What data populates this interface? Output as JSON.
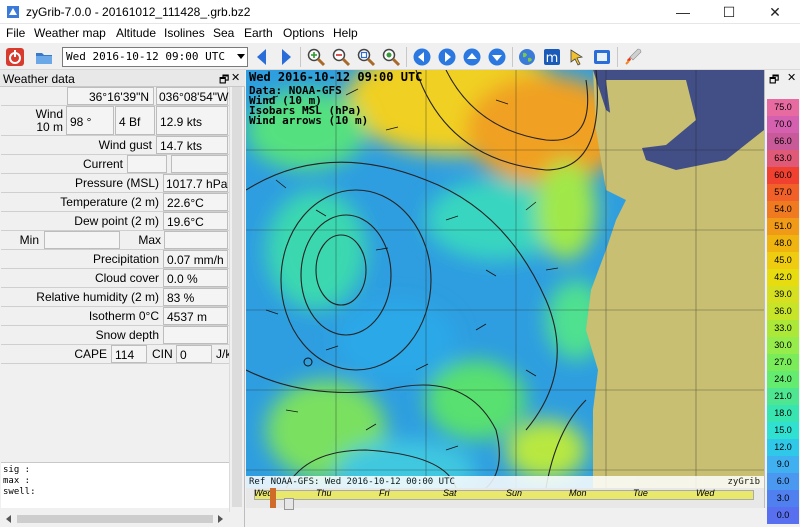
{
  "window": {
    "title": "zyGrib-7.0.0 - 20161012_111428_.grb.bz2",
    "minimize": "—",
    "maximize": "☐",
    "close": "✕"
  },
  "menu": [
    "File",
    "Weather map",
    "Altitude",
    "Isolines",
    "Sea",
    "Earth",
    "Options",
    "Help"
  ],
  "toolbar": {
    "date_value": "Wed 2016-10-12 09:00 UTC"
  },
  "panel": {
    "title": "Weather data",
    "float_icon": "🗗",
    "close_icon": "✕",
    "lat": "36°16'39\"N",
    "lon": "036°08'54\"W",
    "wind_label": "Wind",
    "wind_sub": "10 m",
    "wind_dir": "98 °",
    "wind_bf": "4 Bf",
    "wind_kts": "12.9  kts",
    "gust_label": "Wind gust",
    "gust_value": "14.7  kts",
    "current_label": "Current",
    "pressure_label": "Pressure (MSL)",
    "pressure_value": "1017.7 hPa",
    "temp_label": "Temperature (2 m)",
    "temp_value": "22.6°C",
    "dew_label": "Dew point (2 m)",
    "dew_value": "19.6°C",
    "min_label": "Min",
    "max_label": "Max",
    "precip_label": "Precipitation",
    "precip_value": "0.07 mm/h",
    "cloud_label": "Cloud cover",
    "cloud_value": "0.0 %",
    "rh_label": "Relative humidity (2 m)",
    "rh_value": "83 %",
    "iso_label": "Isotherm 0°C",
    "iso_value": "4537 m",
    "snow_label": "Snow depth",
    "cape_label": "CAPE",
    "cape_value": "114",
    "cin_label": "CIN",
    "cin_value": "0",
    "jk_label": "J/k",
    "sig_label": "sig  :",
    "max_label2": "max  :",
    "swell_label": "swell:"
  },
  "map": {
    "line1": "Wed 2016-10-12 09:00 UTC",
    "line2": "Data: NOAA-GFS",
    "line3": "Wind (10 m)",
    "line4": "Isobars MSL (hPa)",
    "line5": "Wind arrows (10 m)",
    "ref": "Ref NOAA-GFS: Wed 2016-10-12 00:00 UTC",
    "brand": "zyGrib"
  },
  "timeline": {
    "days": [
      "Wed",
      "Thu",
      "Fri",
      "Sat",
      "Sun",
      "Mon",
      "Tue",
      "Wed"
    ],
    "position_fraction": 0.04
  },
  "legend": {
    "float_icon": "🗗",
    "close_icon": "✕",
    "values": [
      "75.0",
      "70.0",
      "66.0",
      "63.0",
      "60.0",
      "57.0",
      "54.0",
      "51.0",
      "48.0",
      "45.0",
      "42.0",
      "39.0",
      "36.0",
      "33.0",
      "30.0",
      "27.0",
      "24.0",
      "21.0",
      "18.0",
      "15.0",
      "12.0",
      "9.0",
      "6.0",
      "3.0",
      "0.0"
    ],
    "colors": [
      "#e76aa0",
      "#d560b0",
      "#c95a9a",
      "#e05a78",
      "#f04030",
      "#f06028",
      "#f07a20",
      "#f09a18",
      "#f0b410",
      "#f0cc10",
      "#e6dc10",
      "#d6e020",
      "#c8e428",
      "#ace838",
      "#96ec4a",
      "#7aec5a",
      "#64ec70",
      "#4ee690",
      "#38e4b0",
      "#30e0d0",
      "#30c8e8",
      "#40b0f0",
      "#4a98f0",
      "#5080f0",
      "#5870f0"
    ]
  }
}
